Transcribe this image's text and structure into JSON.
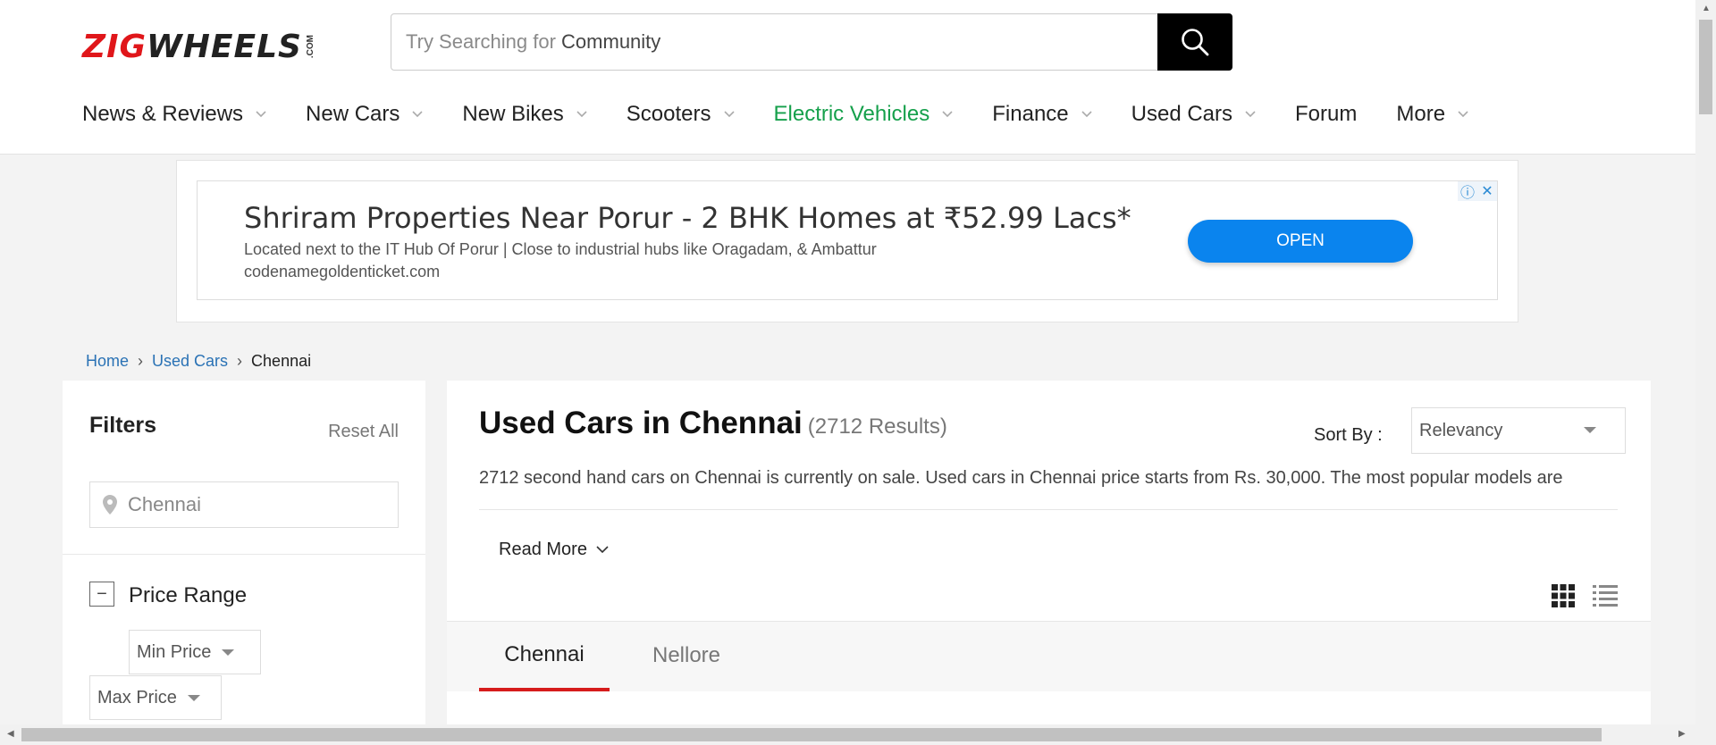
{
  "header": {
    "logo": {
      "zig": "ZIG",
      "wheels": "WHEELS",
      "com": ".COM"
    },
    "search": {
      "prefix": "Try Searching for",
      "keyword": "Community"
    },
    "nav": [
      {
        "label": "News & Reviews",
        "dropdown": true
      },
      {
        "label": "New Cars",
        "dropdown": true
      },
      {
        "label": "New Bikes",
        "dropdown": true
      },
      {
        "label": "Scooters",
        "dropdown": true
      },
      {
        "label": "Electric Vehicles",
        "dropdown": true,
        "color": "#15a04b"
      },
      {
        "label": "Finance",
        "dropdown": true
      },
      {
        "label": "Used Cars",
        "dropdown": true
      },
      {
        "label": "Forum",
        "dropdown": false
      },
      {
        "label": "More",
        "dropdown": true
      }
    ]
  },
  "ad": {
    "title": "Shriram Properties Near Porur - 2 BHK Homes at ₹52.99 Lacs*",
    "description": "Located next to the IT Hub Of Porur | Close to industrial hubs like Oragadam, & Ambattur",
    "domain": "codenamegoldenticket.com",
    "cta": "OPEN",
    "info_icon": "ⓘ",
    "close_icon": "✕"
  },
  "breadcrumb": {
    "home": "Home",
    "used_cars": "Used Cars",
    "current": "Chennai",
    "sep": "›"
  },
  "filters": {
    "title": "Filters",
    "reset": "Reset All",
    "location": "Chennai",
    "price_range_label": "Price Range",
    "price_toggle": "−",
    "min_price": "Min Price",
    "max_price": "Max Price"
  },
  "main": {
    "title": "Used Cars in Chennai",
    "count": "(2712 Results)",
    "sort_label": "Sort By :",
    "sort_value": "Relevancy",
    "description": "2712 second hand cars on Chennai is currently on sale. Used cars in Chennai price starts from Rs. 30,000. The most popular models are",
    "read_more": "Read More",
    "tabs": [
      {
        "label": "Chennai",
        "active": true
      },
      {
        "label": "Nellore",
        "active": false
      }
    ]
  },
  "colors": {
    "brand_red": "#e0161a",
    "accent_blue": "#0a84ee",
    "link_blue": "#2a72b5",
    "ev_green": "#15a04b",
    "tab_red": "#d61c1c"
  }
}
